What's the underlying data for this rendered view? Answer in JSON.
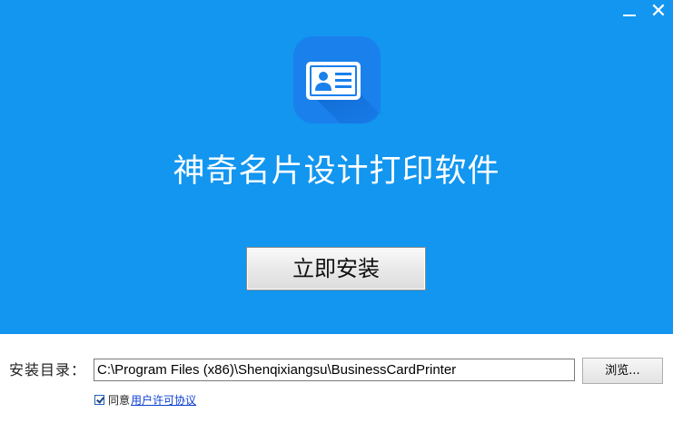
{
  "window": {
    "minimize_icon": "minimize-icon",
    "close_icon": "close-icon",
    "close_glyph": "✕"
  },
  "header": {
    "app_icon": "business-card-icon",
    "title": "神奇名片设计打印软件",
    "accent_color": "#1296f0"
  },
  "actions": {
    "install_label": "立即安装"
  },
  "install_dir": {
    "label": "安装目录：",
    "value": "C:\\Program Files (x86)\\Shenqixiangsu\\BusinessCardPrinter",
    "browse_label": "浏览..."
  },
  "agreement": {
    "checked": true,
    "prefix": "同意",
    "link_label": "用户许可协议"
  }
}
